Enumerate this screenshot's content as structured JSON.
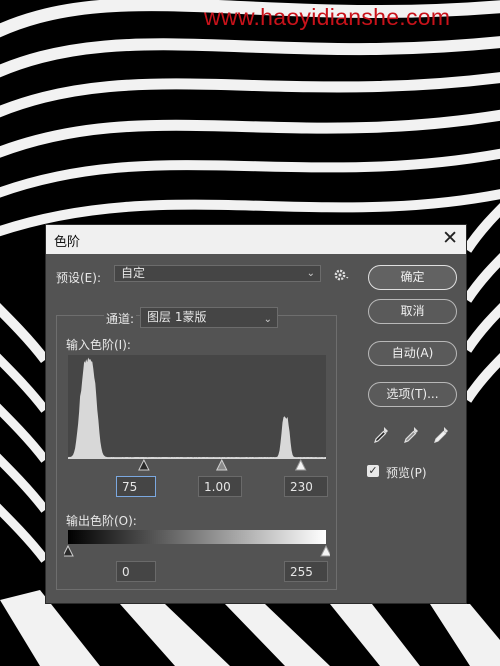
{
  "watermark": "www.haoyidianshe.com",
  "dialog": {
    "title": "色阶",
    "close_glyph": "✕",
    "preset_label": "预设(E):",
    "preset_value": "自定",
    "channel_label": "通道:",
    "channel_value": "图层 1蒙版",
    "input_levels_label": "输入色阶(I):",
    "output_levels_label": "输出色阶(O):",
    "input_values": {
      "black": "75",
      "gamma": "1.00",
      "white": "230"
    },
    "output_values": {
      "black": "0",
      "white": "255"
    },
    "input_slider_positions": {
      "black": 75,
      "gamma": 152,
      "white": 230
    },
    "output_slider_positions": {
      "black": 0,
      "white": 255
    },
    "buttons": {
      "ok": "确定",
      "cancel": "取消",
      "auto": "自动(A)",
      "options": "选项(T)..."
    },
    "preview_label": "预览(P)",
    "preview_checked": true,
    "icons": [
      "gear-icon",
      "black-eyedropper-icon",
      "gray-eyedropper-icon",
      "white-eyedropper-icon"
    ]
  },
  "colors": {
    "panel": "#535353",
    "titlebar": "#f0f0f0",
    "histogram": "#d8d8d8",
    "watermark": "#c8121a"
  },
  "histogram": {
    "range": [
      0,
      255
    ],
    "peaks": [
      {
        "center": 20,
        "width": 8,
        "height": 1.0
      },
      {
        "center": 215,
        "width": 4,
        "height": 0.42
      }
    ]
  }
}
